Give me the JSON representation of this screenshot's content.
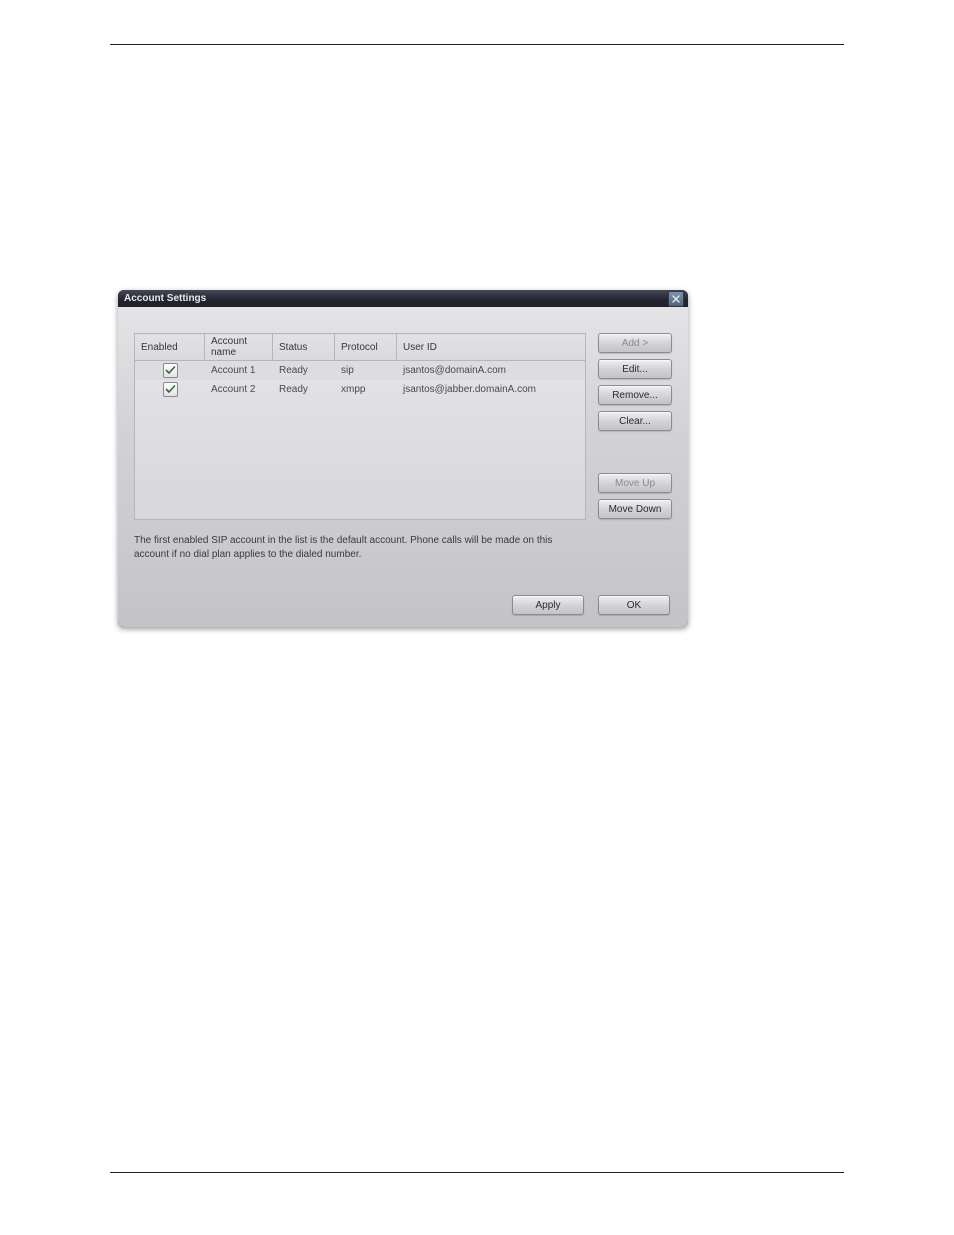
{
  "window": {
    "title": "Account Settings"
  },
  "table": {
    "headers": {
      "enabled": "Enabled",
      "account_name": "Account name",
      "status": "Status",
      "protocol": "Protocol",
      "user_id": "User ID"
    },
    "rows": [
      {
        "enabled": true,
        "account_name": "Account 1",
        "status": "Ready",
        "protocol": "sip",
        "user_id": "jsantos@domainA.com",
        "selected": true
      },
      {
        "enabled": true,
        "account_name": "Account 2",
        "status": "Ready",
        "protocol": "xmpp",
        "user_id": "jsantos@jabber.domainA.com",
        "selected": false
      }
    ]
  },
  "hint": "The first enabled SIP account in the list is the default account. Phone calls will be made on this account if no dial plan applies to the dialed number.",
  "buttons": {
    "add": "Add >",
    "edit": "Edit...",
    "remove": "Remove...",
    "clear": "Clear...",
    "move_up": "Move Up",
    "move_down": "Move Down",
    "apply": "Apply",
    "ok": "OK"
  }
}
